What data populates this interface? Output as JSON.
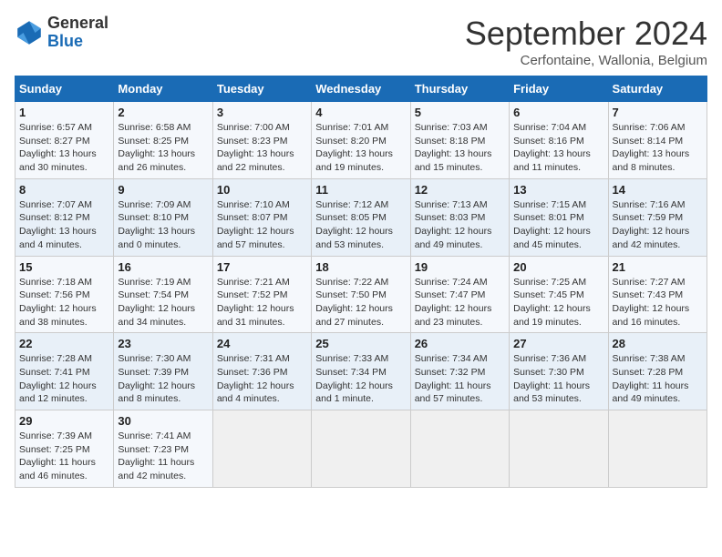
{
  "header": {
    "logo_line1": "General",
    "logo_line2": "Blue",
    "title": "September 2024",
    "subtitle": "Cerfontaine, Wallonia, Belgium"
  },
  "weekdays": [
    "Sunday",
    "Monday",
    "Tuesday",
    "Wednesday",
    "Thursday",
    "Friday",
    "Saturday"
  ],
  "weeks": [
    [
      {
        "day": "1",
        "sunrise": "6:57 AM",
        "sunset": "8:27 PM",
        "daylight": "13 hours and 30 minutes."
      },
      {
        "day": "2",
        "sunrise": "6:58 AM",
        "sunset": "8:25 PM",
        "daylight": "13 hours and 26 minutes."
      },
      {
        "day": "3",
        "sunrise": "7:00 AM",
        "sunset": "8:23 PM",
        "daylight": "13 hours and 22 minutes."
      },
      {
        "day": "4",
        "sunrise": "7:01 AM",
        "sunset": "8:20 PM",
        "daylight": "13 hours and 19 minutes."
      },
      {
        "day": "5",
        "sunrise": "7:03 AM",
        "sunset": "8:18 PM",
        "daylight": "13 hours and 15 minutes."
      },
      {
        "day": "6",
        "sunrise": "7:04 AM",
        "sunset": "8:16 PM",
        "daylight": "13 hours and 11 minutes."
      },
      {
        "day": "7",
        "sunrise": "7:06 AM",
        "sunset": "8:14 PM",
        "daylight": "13 hours and 8 minutes."
      }
    ],
    [
      {
        "day": "8",
        "sunrise": "7:07 AM",
        "sunset": "8:12 PM",
        "daylight": "13 hours and 4 minutes."
      },
      {
        "day": "9",
        "sunrise": "7:09 AM",
        "sunset": "8:10 PM",
        "daylight": "13 hours and 0 minutes."
      },
      {
        "day": "10",
        "sunrise": "7:10 AM",
        "sunset": "8:07 PM",
        "daylight": "12 hours and 57 minutes."
      },
      {
        "day": "11",
        "sunrise": "7:12 AM",
        "sunset": "8:05 PM",
        "daylight": "12 hours and 53 minutes."
      },
      {
        "day": "12",
        "sunrise": "7:13 AM",
        "sunset": "8:03 PM",
        "daylight": "12 hours and 49 minutes."
      },
      {
        "day": "13",
        "sunrise": "7:15 AM",
        "sunset": "8:01 PM",
        "daylight": "12 hours and 45 minutes."
      },
      {
        "day": "14",
        "sunrise": "7:16 AM",
        "sunset": "7:59 PM",
        "daylight": "12 hours and 42 minutes."
      }
    ],
    [
      {
        "day": "15",
        "sunrise": "7:18 AM",
        "sunset": "7:56 PM",
        "daylight": "12 hours and 38 minutes."
      },
      {
        "day": "16",
        "sunrise": "7:19 AM",
        "sunset": "7:54 PM",
        "daylight": "12 hours and 34 minutes."
      },
      {
        "day": "17",
        "sunrise": "7:21 AM",
        "sunset": "7:52 PM",
        "daylight": "12 hours and 31 minutes."
      },
      {
        "day": "18",
        "sunrise": "7:22 AM",
        "sunset": "7:50 PM",
        "daylight": "12 hours and 27 minutes."
      },
      {
        "day": "19",
        "sunrise": "7:24 AM",
        "sunset": "7:47 PM",
        "daylight": "12 hours and 23 minutes."
      },
      {
        "day": "20",
        "sunrise": "7:25 AM",
        "sunset": "7:45 PM",
        "daylight": "12 hours and 19 minutes."
      },
      {
        "day": "21",
        "sunrise": "7:27 AM",
        "sunset": "7:43 PM",
        "daylight": "12 hours and 16 minutes."
      }
    ],
    [
      {
        "day": "22",
        "sunrise": "7:28 AM",
        "sunset": "7:41 PM",
        "daylight": "12 hours and 12 minutes."
      },
      {
        "day": "23",
        "sunrise": "7:30 AM",
        "sunset": "7:39 PM",
        "daylight": "12 hours and 8 minutes."
      },
      {
        "day": "24",
        "sunrise": "7:31 AM",
        "sunset": "7:36 PM",
        "daylight": "12 hours and 4 minutes."
      },
      {
        "day": "25",
        "sunrise": "7:33 AM",
        "sunset": "7:34 PM",
        "daylight": "12 hours and 1 minute."
      },
      {
        "day": "26",
        "sunrise": "7:34 AM",
        "sunset": "7:32 PM",
        "daylight": "11 hours and 57 minutes."
      },
      {
        "day": "27",
        "sunrise": "7:36 AM",
        "sunset": "7:30 PM",
        "daylight": "11 hours and 53 minutes."
      },
      {
        "day": "28",
        "sunrise": "7:38 AM",
        "sunset": "7:28 PM",
        "daylight": "11 hours and 49 minutes."
      }
    ],
    [
      {
        "day": "29",
        "sunrise": "7:39 AM",
        "sunset": "7:25 PM",
        "daylight": "11 hours and 46 minutes."
      },
      {
        "day": "30",
        "sunrise": "7:41 AM",
        "sunset": "7:23 PM",
        "daylight": "11 hours and 42 minutes."
      },
      null,
      null,
      null,
      null,
      null
    ]
  ]
}
